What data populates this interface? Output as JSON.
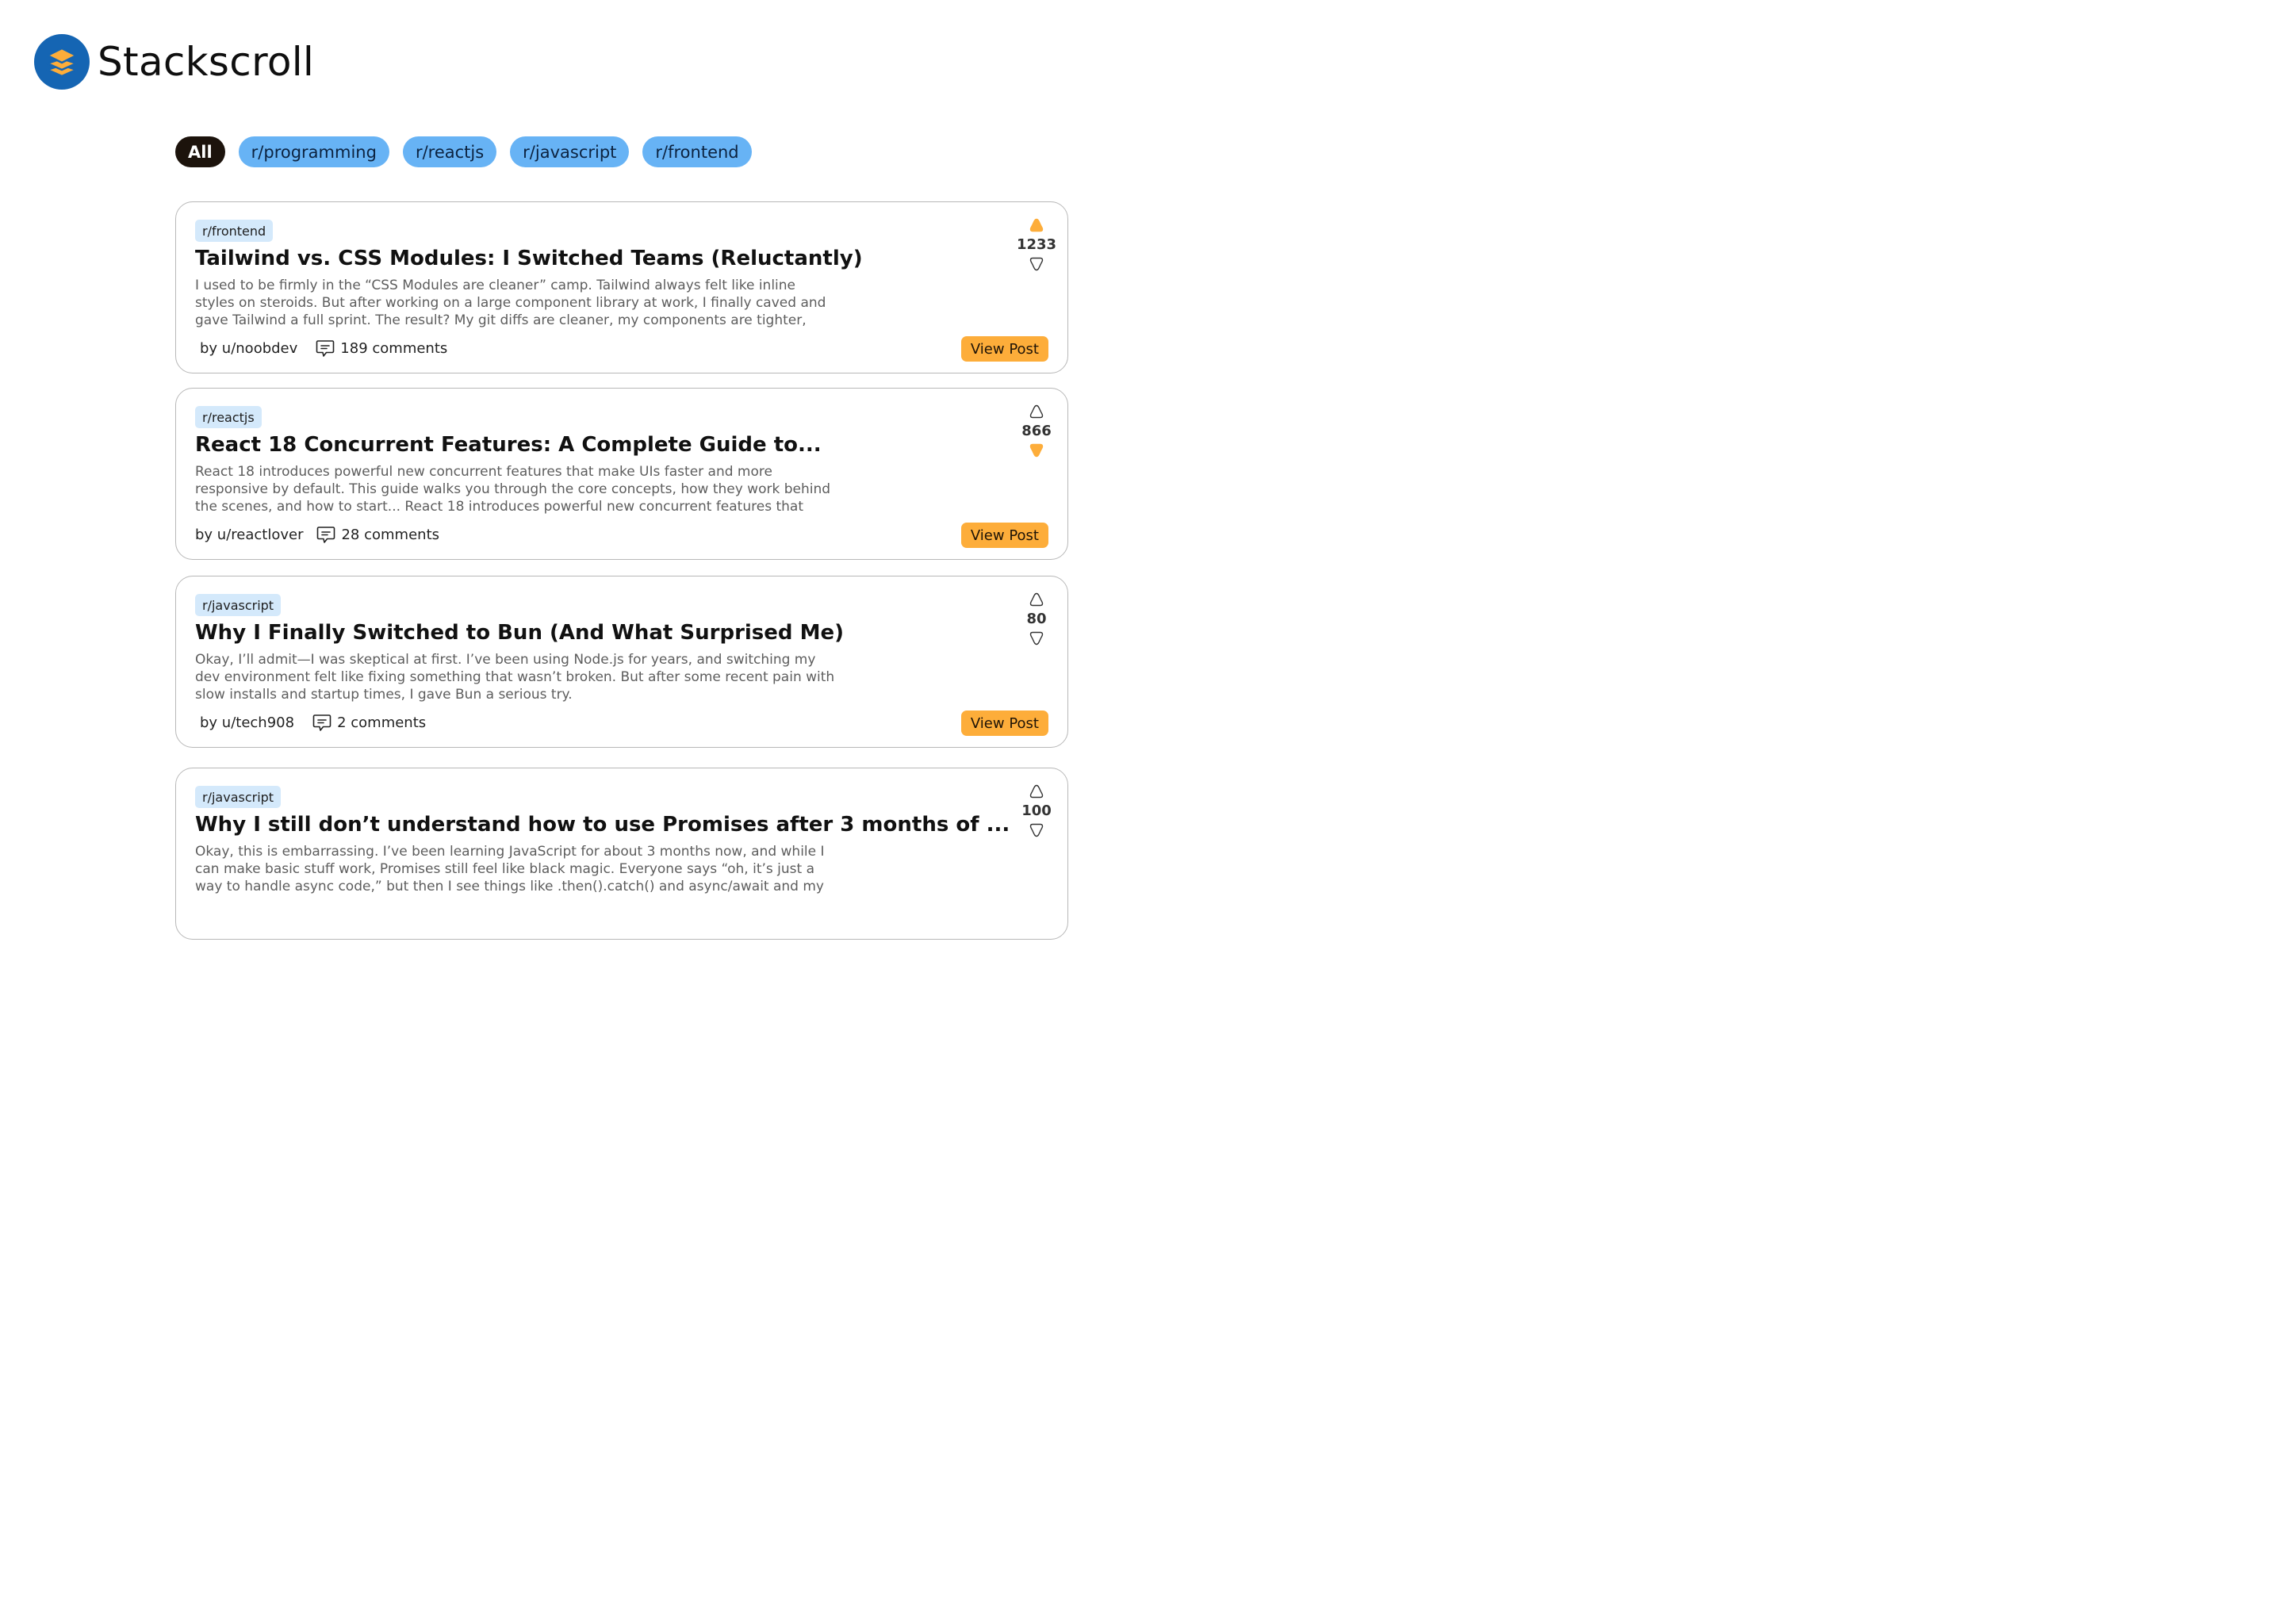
{
  "app": {
    "brand": "Stackscroll"
  },
  "colors": {
    "accent": "#fdad3a",
    "chip": "#67b3f5",
    "chip_active": "#1c130c",
    "logo": "#1565b3",
    "tag": "#d4e9fb"
  },
  "filters": [
    {
      "label": "All",
      "active": true
    },
    {
      "label": "r/programming",
      "active": false
    },
    {
      "label": "r/reactjs",
      "active": false
    },
    {
      "label": "r/javascript",
      "active": false
    },
    {
      "label": "r/frontend",
      "active": false
    }
  ],
  "posts": [
    {
      "subreddit": "r/frontend",
      "title": "Tailwind vs. CSS Modules: I Switched Teams (Reluctantly)",
      "body": "I used to be firmly in the “CSS Modules are cleaner” camp. Tailwind always felt like inline styles on steroids. But after working on a large component library at work, I finally caved and gave Tailwind a full sprint. The result? My git diffs are cleaner, my components are tighter, and... I’m kind of loving",
      "author": "by u/noobdev",
      "comments": "189 comments",
      "score": "1233",
      "vote": "up",
      "cta": "View Post"
    },
    {
      "subreddit": "r/reactjs",
      "title": "React 18 Concurrent Features: A Complete Guide to...",
      "body": "React 18 introduces powerful new concurrent features that make UIs faster and more responsive by default. This guide walks you through the core concepts, how they work behind the scenes, and how to start... React 18 introduces powerful new concurrent features that make UIs faster and",
      "author": "by u/reactlover",
      "comments": "28 comments",
      "score": "866",
      "vote": "down",
      "cta": "View Post"
    },
    {
      "subreddit": "r/javascript",
      "title": "Why I Finally Switched to Bun (And What Surprised Me)",
      "body": "Okay, I’ll admit—I was skeptical at first. I’ve been using Node.js for years, and switching my dev environment felt like fixing something that wasn’t broken. But after some recent pain with slow installs and startup times, I gave Bun a serious try.",
      "author": "by u/tech908",
      "comments": "2 comments",
      "score": "80",
      "vote": "none",
      "cta": "View Post"
    },
    {
      "subreddit": "r/javascript",
      "title": "Why I still don’t understand how to use Promises after 3 months of ...",
      "body": "Okay, this is embarrassing. I’ve been learning JavaScript for about 3 months now, and while I can make basic stuff work, Promises still feel like black magic. Everyone says “oh, it’s just a way to handle async code,” but then I see things like .then().catch() and async/await and my brain just melts.",
      "author": "",
      "comments": "",
      "score": "100",
      "vote": "none",
      "cta": ""
    }
  ]
}
